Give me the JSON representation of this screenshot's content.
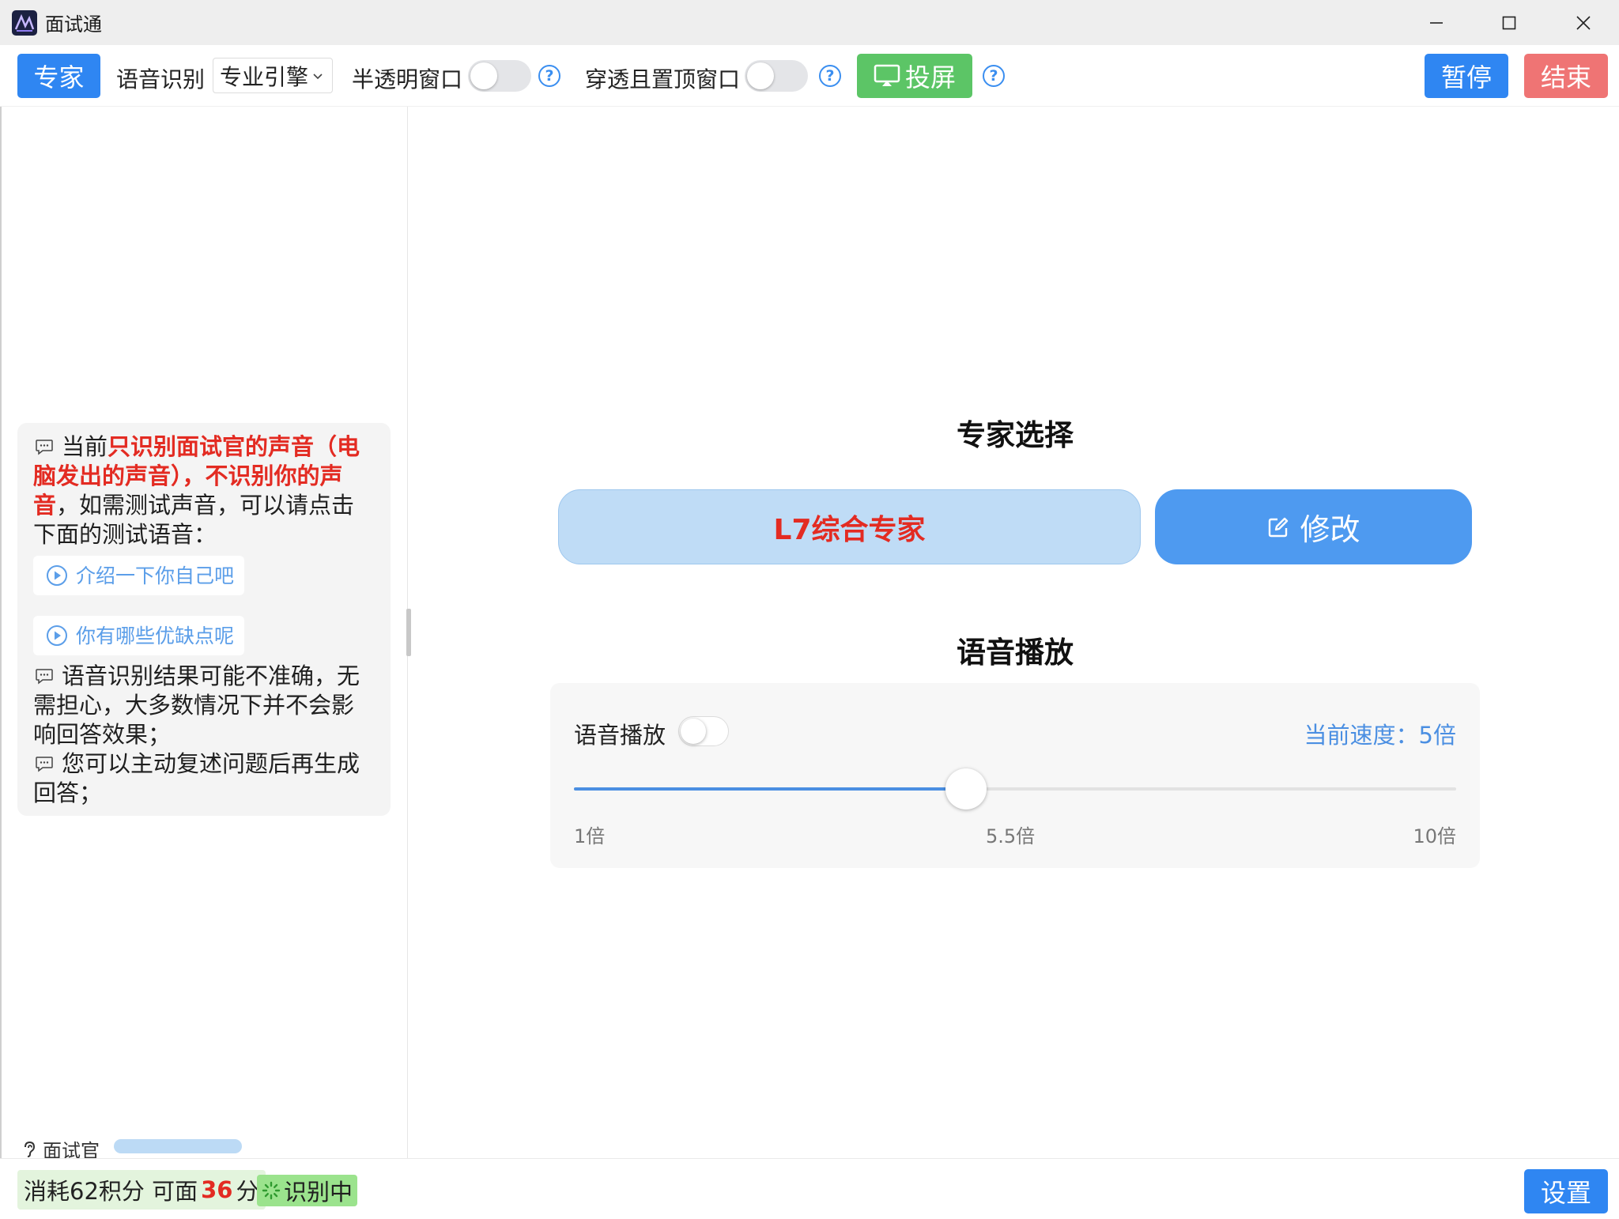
{
  "window": {
    "title": "面试通",
    "controls": {
      "minimize": "minimize",
      "maximize": "maximize",
      "close": "close"
    }
  },
  "toolbar": {
    "expert_button": "专家",
    "speech_label": "语音识别",
    "engine_value": "专业引擎",
    "translucent_label": "半透明窗口",
    "translucent_on": false,
    "passthrough_label": "穿透且置顶窗口",
    "passthrough_on": false,
    "cast_button": "投屏",
    "pause_button": "暂停",
    "end_button": "结束"
  },
  "left_panel": {
    "notice": {
      "prefix": "当前",
      "highlight": "只识别面试官的声音（电脑发出的声音），不识别你的声音",
      "suffix": "，如需测试声音，可以请点击下面的测试语音："
    },
    "test_prompts": [
      "介绍一下你自己吧",
      "你有哪些优缺点呢"
    ],
    "tips": [
      "语音识别结果可能不准确，无需担心，大多数情况下并不会影响回答效果；",
      "您可以主动复述问题后再生成回答；"
    ],
    "interviewer_label": "面试官"
  },
  "main": {
    "expert_section_title": "专家选择",
    "expert_name": "L7综合专家",
    "edit_button": "修改",
    "voice_section_title": "语音播放",
    "voice_toggle_label": "语音播放",
    "voice_toggle_on": false,
    "current_speed_label": "当前速度：5倍",
    "slider": {
      "min": 1,
      "max": 10,
      "value": 5
    },
    "ticks": [
      "1倍",
      "5.5倍",
      "10倍"
    ]
  },
  "bottom": {
    "points_prefix": "消耗62积分 可面",
    "points_value": "36",
    "points_suffix": "分",
    "status": "识别中",
    "settings_button": "设置"
  },
  "colors": {
    "primary": "#2f86f2",
    "success": "#5cc566",
    "danger": "#ef7474",
    "highlight_red": "#e32b22"
  }
}
